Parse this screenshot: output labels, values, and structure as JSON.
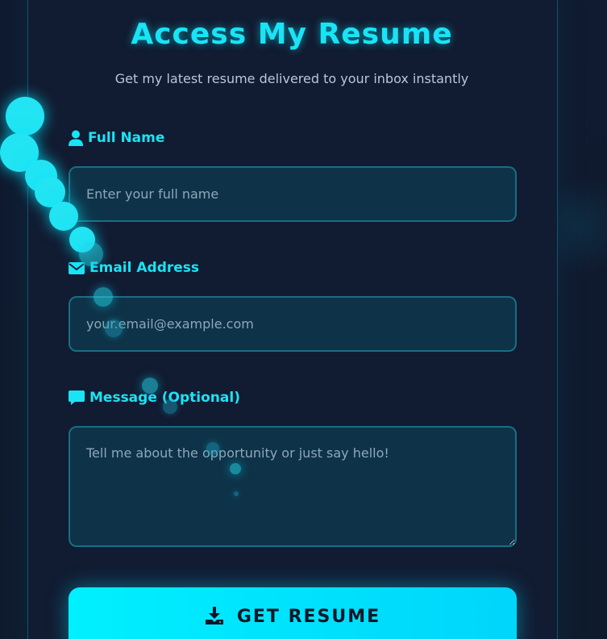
{
  "header": {
    "title": "Access My Resume",
    "subtitle": "Get my latest resume delivered to your inbox instantly"
  },
  "form": {
    "name": {
      "label": "Full Name",
      "icon": "user-icon",
      "placeholder": "Enter your full name",
      "value": ""
    },
    "email": {
      "label": "Email Address",
      "icon": "envelope-icon",
      "placeholder": "your.email@example.com",
      "value": ""
    },
    "message": {
      "label": "Message (Optional)",
      "icon": "comment-icon",
      "placeholder": "Tell me about the opportunity or just say hello!",
      "value": ""
    },
    "submit": {
      "label": "GET RESUME",
      "icon": "download-icon"
    }
  },
  "colors": {
    "accent": "#19e4f5",
    "background": "#111b31",
    "field_bg": "#0e3348",
    "field_border": "#1b6d84",
    "button_bg": "#00e5ff",
    "button_text": "#0c1626"
  }
}
